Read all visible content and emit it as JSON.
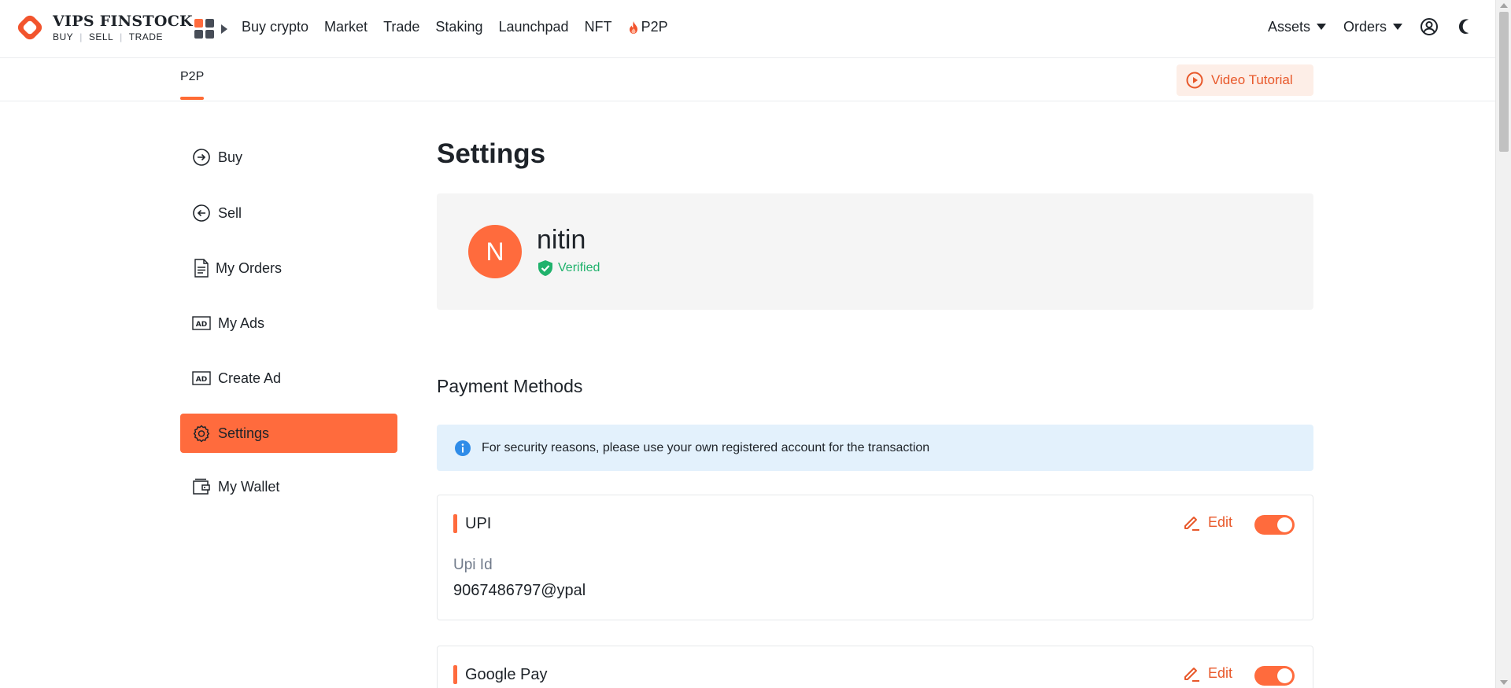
{
  "brand": {
    "name": "VIPS FINSTOCK",
    "tagline": [
      "BUY",
      "SELL",
      "TRADE"
    ],
    "accent_color": "#ff6b3d"
  },
  "topnav": {
    "links": [
      "Buy crypto",
      "Market",
      "Trade",
      "Staking",
      "Launchpad",
      "NFT",
      "P2P"
    ],
    "right": {
      "assets": "Assets",
      "orders": "Orders"
    },
    "icons": {
      "apps": "grid-icon",
      "p2p": "fire-icon",
      "user": "user-circle-icon",
      "theme": "moon-icon"
    }
  },
  "subheader": {
    "tab": "P2P",
    "video_tutorial": "Video Tutorial"
  },
  "sidebar": {
    "items": [
      {
        "label": "Buy",
        "icon": "arrow-right-circle-icon",
        "active": false
      },
      {
        "label": "Sell",
        "icon": "arrow-left-circle-icon",
        "active": false
      },
      {
        "label": "My Orders",
        "icon": "document-icon",
        "active": false
      },
      {
        "label": "My Ads",
        "icon": "ad-icon",
        "active": false
      },
      {
        "label": "Create Ad",
        "icon": "ad-icon",
        "active": false
      },
      {
        "label": "Settings",
        "icon": "gear-icon",
        "active": true
      },
      {
        "label": "My Wallet",
        "icon": "wallet-icon",
        "active": false
      }
    ]
  },
  "main": {
    "title": "Settings",
    "profile": {
      "initial": "N",
      "username": "nitin",
      "status": "Verified"
    },
    "payment_methods": {
      "title": "Payment Methods",
      "notice": "For security reasons, please use your own registered account for the transaction",
      "methods": [
        {
          "name": "UPI",
          "edit_label": "Edit",
          "enabled": true,
          "field_label": "Upi Id",
          "field_value": "9067486797@ypal"
        },
        {
          "name": "Google Pay",
          "edit_label": "Edit",
          "enabled": true
        }
      ]
    }
  }
}
